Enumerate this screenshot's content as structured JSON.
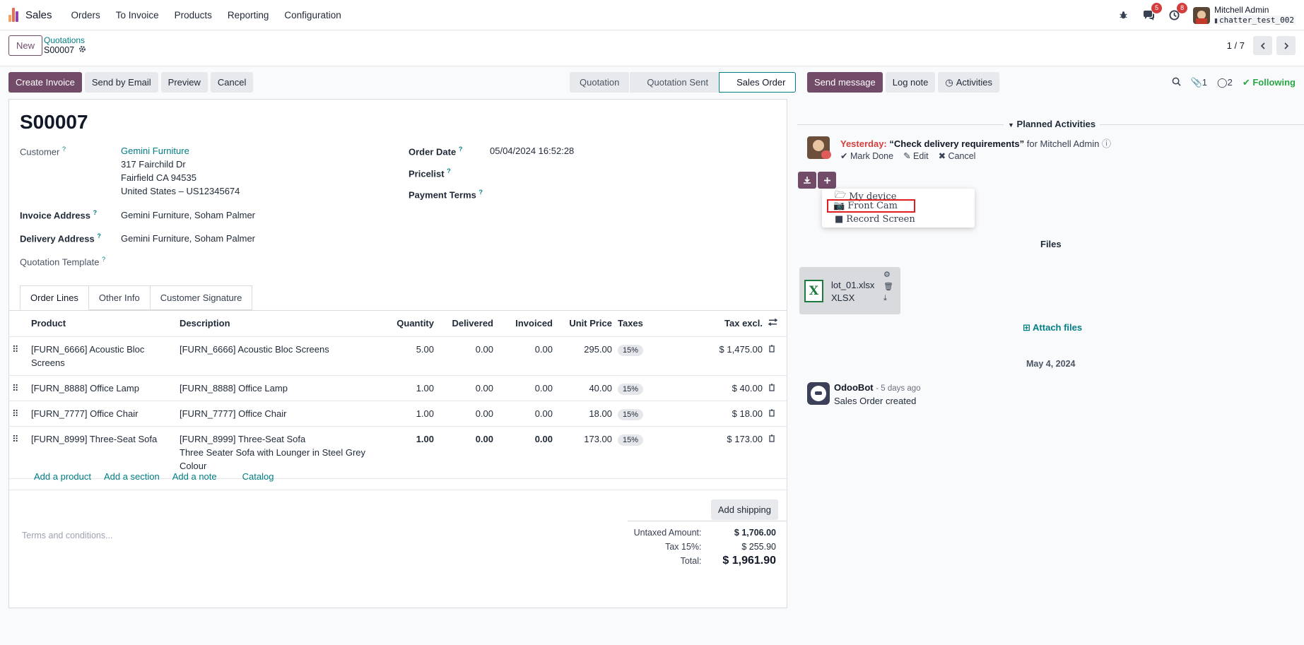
{
  "navbar": {
    "app_name": "Sales",
    "menu": [
      "Orders",
      "To Invoice",
      "Products",
      "Reporting",
      "Configuration"
    ],
    "messages_count": "5",
    "activities_count": "8",
    "user_name": "Mitchell Admin",
    "database": "chatter_test_002"
  },
  "control_panel": {
    "new_label": "New",
    "breadcrumb_parent": "Quotations",
    "record_name": "S00007",
    "pager": "1 / 7"
  },
  "actions": {
    "create_invoice": "Create Invoice",
    "send_email": "Send by Email",
    "preview": "Preview",
    "cancel": "Cancel"
  },
  "statusbar": {
    "stages": [
      "Quotation",
      "Quotation Sent",
      "Sales Order"
    ],
    "active": "Sales Order"
  },
  "form": {
    "title": "S00007",
    "customer_label": "Customer",
    "customer_name": "Gemini Furniture",
    "customer_addr1": "317 Fairchild Dr",
    "customer_addr2": "Fairfield CA 94535",
    "customer_addr3": "United States – US12345674",
    "invoice_address_label": "Invoice Address",
    "invoice_address": "Gemini Furniture, Soham Palmer",
    "delivery_address_label": "Delivery Address",
    "delivery_address": "Gemini Furniture, Soham Palmer",
    "quotation_template_label": "Quotation Template",
    "order_date_label": "Order Date",
    "order_date": "05/04/2024 16:52:28",
    "pricelist_label": "Pricelist",
    "payment_terms_label": "Payment Terms",
    "help_mark": "?"
  },
  "tabs": [
    "Order Lines",
    "Other Info",
    "Customer Signature"
  ],
  "lines": {
    "headers": [
      "Product",
      "Description",
      "Quantity",
      "Delivered",
      "Invoiced",
      "Unit Price",
      "Taxes",
      "Tax excl."
    ],
    "rows": [
      {
        "product": "[FURN_6666] Acoustic Bloc Screens",
        "desc1": "[FURN_6666] Acoustic Bloc Screens",
        "desc2": "",
        "desc3": "",
        "qty": "5.00",
        "delivered": "0.00",
        "invoiced": "0.00",
        "price": "295.00",
        "tax": "15%",
        "subtotal": "$ 1,475.00"
      },
      {
        "product": "[FURN_8888] Office Lamp",
        "desc1": "[FURN_8888] Office Lamp",
        "desc2": "",
        "desc3": "",
        "qty": "1.00",
        "delivered": "0.00",
        "invoiced": "0.00",
        "price": "40.00",
        "tax": "15%",
        "subtotal": "$ 40.00"
      },
      {
        "product": "[FURN_7777] Office Chair",
        "desc1": "[FURN_7777] Office Chair",
        "desc2": "",
        "desc3": "",
        "qty": "1.00",
        "delivered": "0.00",
        "invoiced": "0.00",
        "price": "18.00",
        "tax": "15%",
        "subtotal": "$ 18.00"
      },
      {
        "product": "[FURN_8999] Three-Seat Sofa",
        "desc1": "[FURN_8999] Three-Seat Sofa",
        "desc2": "Three Seater Sofa with Lounger in Steel Grey",
        "desc3": "Colour",
        "qty": "1.00",
        "delivered": "0.00",
        "invoiced": "0.00",
        "price": "173.00",
        "tax": "15%",
        "subtotal": "$ 173.00"
      }
    ],
    "add_product": "Add a product",
    "add_section": "Add a section",
    "add_note": "Add a note",
    "catalog": "Catalog"
  },
  "footer": {
    "add_shipping": "Add shipping",
    "terms_placeholder": "Terms and conditions...",
    "untaxed_label": "Untaxed Amount:",
    "untaxed": "$ 1,706.00",
    "tax_label": "Tax 15%:",
    "tax": "$ 255.90",
    "total_label": "Total:",
    "total": "$ 1,961.90"
  },
  "chatter": {
    "send_message": "Send message",
    "log_note": "Log note",
    "activities": "Activities",
    "attachments_count": "1",
    "followers_count": "2",
    "following": "Following",
    "planned_label": "Planned Activities",
    "activity_when": "Yesterday:",
    "activity_summary": "“Check delivery requirements”",
    "activity_for": "for Mitchell Admin",
    "mark_done": "Mark Done",
    "edit": "Edit",
    "cancel": "Cancel",
    "upload_menu": [
      "My device",
      "Front Cam",
      "Record Screen"
    ],
    "files_label": "Files",
    "file_name": "lot_01.xlsx",
    "file_type": "XLSX",
    "attach_files": "Attach files",
    "date_separator": "May 4, 2024",
    "msg_author": "OdooBot",
    "msg_time": "- 5 days ago",
    "msg_body": "Sales Order created"
  },
  "colors": {
    "brand": "#714b67",
    "link": "#017e84",
    "badge": "#d43d3d",
    "following": "#28a745",
    "highlight_box": "#e11d1d"
  }
}
